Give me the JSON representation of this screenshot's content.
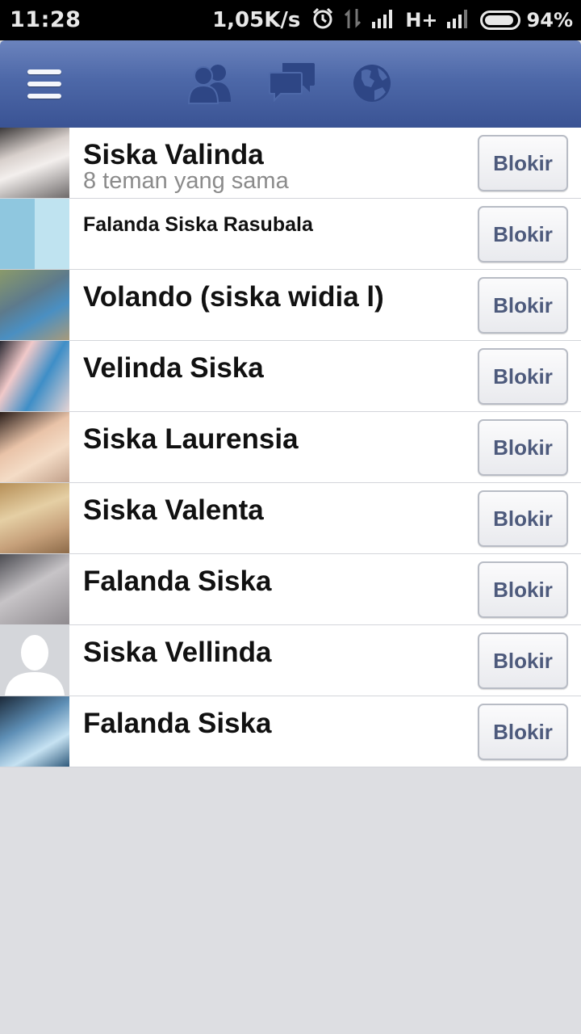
{
  "status_bar": {
    "time": "11:28",
    "speed": "1,05K/s",
    "network": "H+",
    "battery_percent": "94%",
    "battery_level": 0.94,
    "icons": [
      "alarm-icon",
      "data-transfer-icon",
      "signal-icon",
      "signal-icon",
      "battery-icon"
    ]
  },
  "nav": {
    "icons": [
      "menu-icon",
      "friend-requests-icon",
      "messages-icon",
      "notifications-globe-icon"
    ],
    "colors": {
      "bar_top": "#6b83bd",
      "bar_bottom": "#3a5394",
      "icon": "#2e4685"
    }
  },
  "people": [
    {
      "name": "Siska Valinda",
      "subtext": "8 teman yang sama",
      "button": "Blokir",
      "avatar": "photo"
    },
    {
      "name": "Falanda Siska Rasubala",
      "subtext": "",
      "button": "Blokir",
      "avatar": "photo"
    },
    {
      "name": "Volando (siska widia l)",
      "subtext": "",
      "button": "Blokir",
      "avatar": "photo"
    },
    {
      "name": "Velinda Siska",
      "subtext": "",
      "button": "Blokir",
      "avatar": "photo"
    },
    {
      "name": "Siska Laurensia",
      "subtext": "",
      "button": "Blokir",
      "avatar": "photo"
    },
    {
      "name": "Siska Valenta",
      "subtext": "",
      "button": "Blokir",
      "avatar": "photo"
    },
    {
      "name": "Falanda Siska",
      "subtext": "",
      "button": "Blokir",
      "avatar": "photo"
    },
    {
      "name": "Siska Vellinda",
      "subtext": "",
      "button": "Blokir",
      "avatar": "default-silhouette"
    },
    {
      "name": "Falanda Siska",
      "subtext": "",
      "button": "Blokir",
      "avatar": "photo"
    }
  ],
  "colors": {
    "button_text": "#4d5a7c",
    "page_background": "#dddee2"
  }
}
